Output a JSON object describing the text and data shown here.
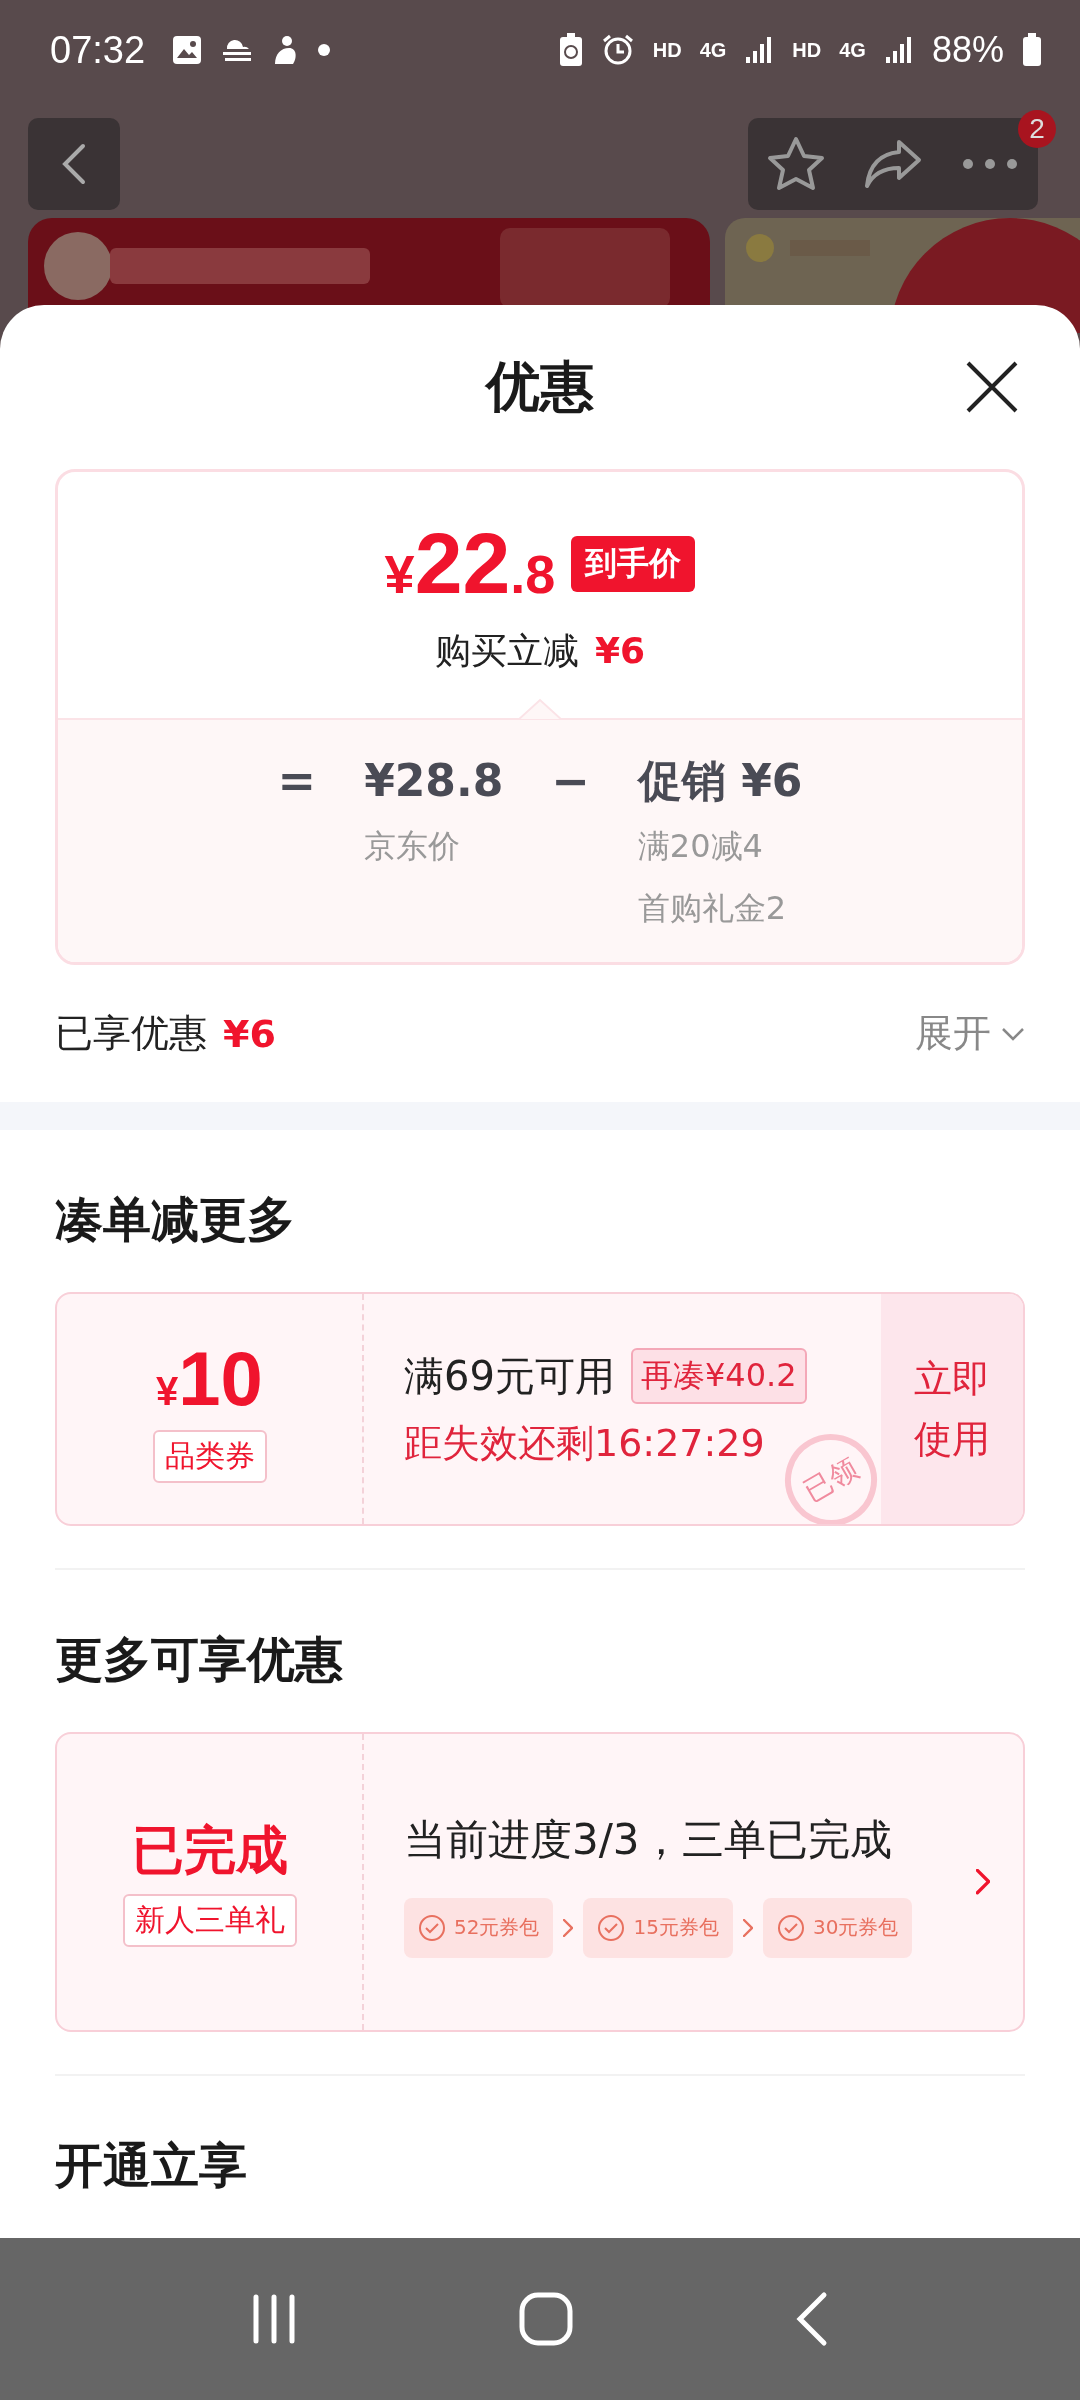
{
  "status_bar": {
    "time": "07:32",
    "indicators": [
      "HD",
      "4G",
      "HD",
      "4G"
    ],
    "battery": "88%"
  },
  "header": {
    "badge": "2"
  },
  "sheet": {
    "title": "优惠"
  },
  "price_card": {
    "currency": "¥",
    "integer": "22",
    "decimal": ".8",
    "price_tag": "到手价",
    "saving_label": "购买立减",
    "saving_amount": "¥6",
    "breakdown": [
      {
        "kind": "operator",
        "text": "="
      },
      {
        "kind": "term",
        "amount": "¥28.8",
        "notes": [
          "京东价"
        ]
      },
      {
        "kind": "operator",
        "text": "−"
      },
      {
        "kind": "term",
        "amount": "促销 ¥6",
        "notes": [
          "满20减4",
          "首购礼金2"
        ]
      }
    ]
  },
  "enjoyed": {
    "label": "已享优惠",
    "amount": "¥6",
    "toggle": "展开",
    "expanded": false
  },
  "sections": [
    {
      "kind": "coupon",
      "title": "凑单减更多",
      "currency": "¥",
      "value": "10",
      "type": "品类券",
      "condition": "满69元可用",
      "tag": "再凑¥40.2",
      "countdown": "距失效还剩16:27:29",
      "stamp": "已领",
      "action": "立即使用"
    },
    {
      "kind": "task",
      "title": "更多可享优惠",
      "status": "已完成",
      "name": "新人三单礼",
      "progress": "当前进度3/3，三单已完成",
      "steps": [
        {
          "label": "52元券包",
          "done": true
        },
        {
          "label": "15元券包",
          "done": true
        },
        {
          "label": "30元券包",
          "done": true
        }
      ]
    },
    {
      "kind": "heading",
      "title": "开通立享"
    }
  ]
}
